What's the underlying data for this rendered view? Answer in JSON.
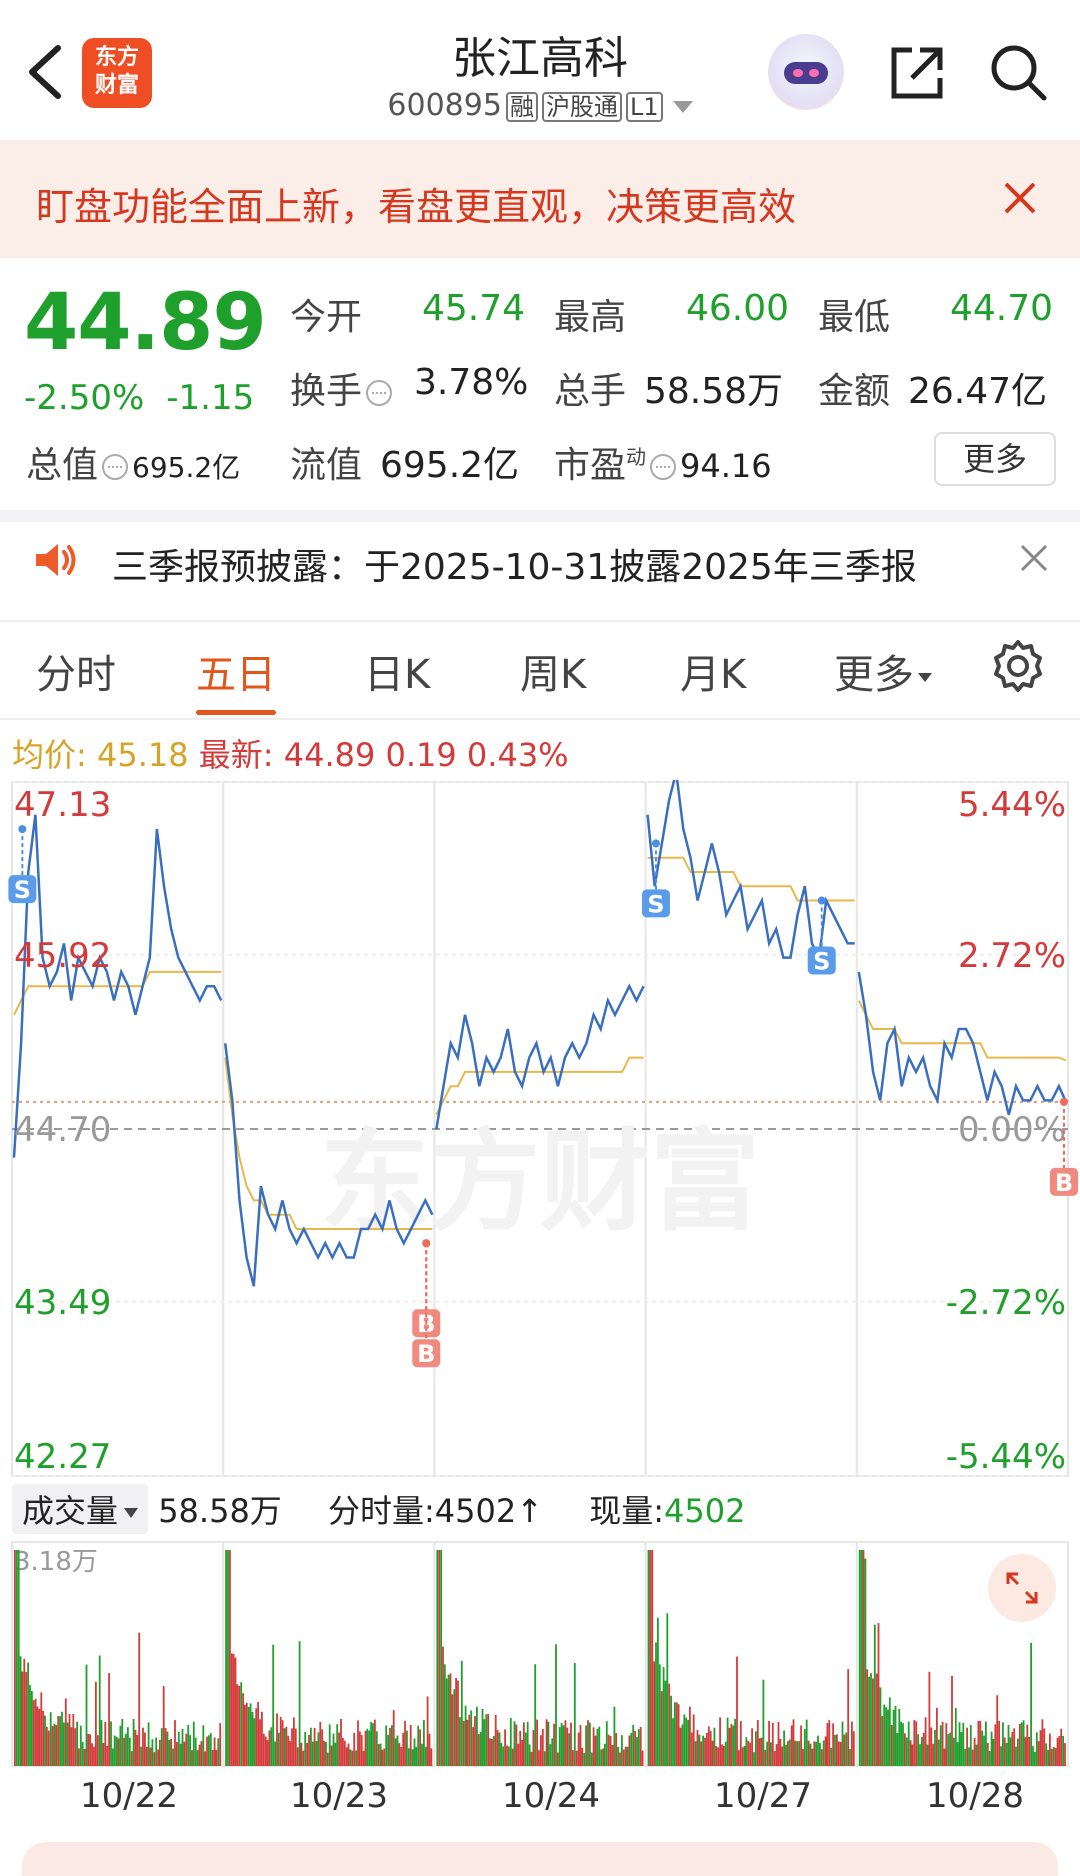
{
  "header": {
    "title": "张江高科",
    "code": "600895",
    "tags": [
      "融",
      "沪股通",
      "L1"
    ],
    "logo_line1": "东方",
    "logo_line2": "财富"
  },
  "banner": {
    "text": "盯盘功能全面上新，看盘更直观，决策更高效"
  },
  "quote": {
    "price": "44.89",
    "change_pct": "-2.50%",
    "change_abs": "-1.15",
    "open_label": "今开",
    "open": "45.74",
    "high_label": "最高",
    "high": "46.00",
    "low_label": "最低",
    "low": "44.70",
    "turnover_label": "换手",
    "turnover": "3.78%",
    "volume_label": "总手",
    "volume": "58.58万",
    "amount_label": "金额",
    "amount": "26.47亿",
    "mktcap_label": "总值",
    "mktcap": "695.2亿",
    "float_label": "流值",
    "float": "695.2亿",
    "pe_label": "市盈",
    "pe_sup": "动",
    "pe": "94.16",
    "more": "更多"
  },
  "notice": {
    "text": "三季报预披露：于2025-10-31披露2025年三季报"
  },
  "tabs": [
    "分时",
    "五日",
    "日K",
    "周K",
    "月K",
    "更多"
  ],
  "active_tab": "五日",
  "avg": {
    "avg_label": "均价:",
    "avg_value": "45.18",
    "latest_label": "最新:",
    "latest_value": "44.89",
    "diff": "0.19",
    "diff_pct": "0.43%"
  },
  "chart_data": {
    "type": "line",
    "y_left_ticks": [
      "47.13",
      "45.92",
      "44.70",
      "43.49",
      "42.27"
    ],
    "y_right_ticks": [
      "5.44%",
      "2.72%",
      "0.00%",
      "-2.72%",
      "-5.44%"
    ],
    "x_labels": [
      "10/22",
      "10/23",
      "10/24",
      "10/27",
      "10/28"
    ],
    "ylim": [
      42.27,
      47.13
    ],
    "prev_close": 44.7,
    "colors": {
      "price": "#3a6fbf",
      "avg": "#e8b84a",
      "up": "#d43a3a",
      "down": "#1fa02c"
    },
    "series": [
      {
        "name": "price",
        "values": [
          44.5,
          45.3,
          46.5,
          46.9,
          45.9,
          45.7,
          45.8,
          46.0,
          45.6,
          45.9,
          45.8,
          45.7,
          45.9,
          45.8,
          45.6,
          45.8,
          45.7,
          45.5,
          45.7,
          45.9,
          46.8,
          46.4,
          46.1,
          45.9,
          45.8,
          45.7,
          45.6,
          45.7,
          45.7,
          45.6,
          45.3,
          44.9,
          44.2,
          43.8,
          43.6,
          44.3,
          44.1,
          44.0,
          44.2,
          44.0,
          43.9,
          44.0,
          43.9,
          43.8,
          43.9,
          43.8,
          43.9,
          43.8,
          43.8,
          44.0,
          44.0,
          44.1,
          44.0,
          44.2,
          44.0,
          43.9,
          44.0,
          44.1,
          44.2,
          44.1,
          44.7,
          45.0,
          45.3,
          45.2,
          45.5,
          45.3,
          45.0,
          45.2,
          45.1,
          45.2,
          45.4,
          45.1,
          45.0,
          45.2,
          45.3,
          45.1,
          45.2,
          45.0,
          45.2,
          45.3,
          45.2,
          45.3,
          45.5,
          45.4,
          45.6,
          45.5,
          45.6,
          45.7,
          45.6,
          45.7,
          46.9,
          46.4,
          46.7,
          47.0,
          47.2,
          46.8,
          46.6,
          46.3,
          46.5,
          46.7,
          46.5,
          46.2,
          46.3,
          46.4,
          46.1,
          46.2,
          46.3,
          46.0,
          46.1,
          45.9,
          45.9,
          46.2,
          46.4,
          46.0,
          45.9,
          46.3,
          46.2,
          46.1,
          46.0,
          46.0,
          45.8,
          45.5,
          45.1,
          44.9,
          45.3,
          45.4,
          45.0,
          45.2,
          45.1,
          45.2,
          45.0,
          44.9,
          45.3,
          45.2,
          45.4,
          45.4,
          45.3,
          45.1,
          44.9,
          45.1,
          45.0,
          44.8,
          45.0,
          44.9,
          44.9,
          45.0,
          44.9,
          44.9,
          45.0,
          44.89
        ]
      },
      {
        "name": "avg",
        "values": [
          45.5,
          45.6,
          45.7,
          45.7,
          45.7,
          45.7,
          45.7,
          45.7,
          45.7,
          45.7,
          45.7,
          45.7,
          45.7,
          45.7,
          45.7,
          45.7,
          45.7,
          45.7,
          45.7,
          45.8,
          45.8,
          45.8,
          45.8,
          45.8,
          45.8,
          45.8,
          45.8,
          45.8,
          45.8,
          45.8,
          45.2,
          44.8,
          44.5,
          44.3,
          44.2,
          44.2,
          44.1,
          44.1,
          44.1,
          44.1,
          44.0,
          44.0,
          44.0,
          44.0,
          44.0,
          44.0,
          44.0,
          44.0,
          44.0,
          44.0,
          44.0,
          44.0,
          44.0,
          44.0,
          44.0,
          44.0,
          44.0,
          44.0,
          44.0,
          44.0,
          44.8,
          44.9,
          45.0,
          45.0,
          45.1,
          45.1,
          45.1,
          45.1,
          45.1,
          45.1,
          45.1,
          45.1,
          45.1,
          45.1,
          45.1,
          45.1,
          45.1,
          45.1,
          45.1,
          45.1,
          45.1,
          45.1,
          45.1,
          45.1,
          45.1,
          45.1,
          45.1,
          45.2,
          45.2,
          45.2,
          46.6,
          46.6,
          46.6,
          46.6,
          46.6,
          46.6,
          46.5,
          46.5,
          46.5,
          46.5,
          46.5,
          46.5,
          46.5,
          46.4,
          46.4,
          46.4,
          46.4,
          46.4,
          46.4,
          46.4,
          46.4,
          46.3,
          46.3,
          46.3,
          46.3,
          46.3,
          46.3,
          46.3,
          46.3,
          46.3,
          45.6,
          45.5,
          45.4,
          45.4,
          45.4,
          45.4,
          45.3,
          45.3,
          45.3,
          45.3,
          45.3,
          45.3,
          45.3,
          45.3,
          45.3,
          45.3,
          45.3,
          45.3,
          45.2,
          45.2,
          45.2,
          45.2,
          45.2,
          45.2,
          45.2,
          45.2,
          45.2,
          45.2,
          45.2,
          45.18
        ]
      }
    ],
    "markers": [
      {
        "label": "S",
        "day": 0,
        "at": 0.05,
        "price": 46.8
      },
      {
        "label": "B",
        "day": 1,
        "at": 0.98,
        "price": 43.9
      },
      {
        "label": "B",
        "day": 1,
        "at": 0.98,
        "price": 43.9
      },
      {
        "label": "S",
        "day": 3,
        "at": 0.05,
        "price": 46.7
      },
      {
        "label": "S",
        "day": 3,
        "at": 0.85,
        "price": 46.3
      },
      {
        "label": "B",
        "day": 4,
        "at": 1.0,
        "price": 44.89
      }
    ]
  },
  "volume": {
    "selector": "成交量",
    "total": "58.58万",
    "tick_label": "分时量:",
    "tick_value": "4502",
    "current_label": "现量:",
    "current_value": "4502",
    "max_label": "3.18万"
  },
  "watermark": "东方财富"
}
